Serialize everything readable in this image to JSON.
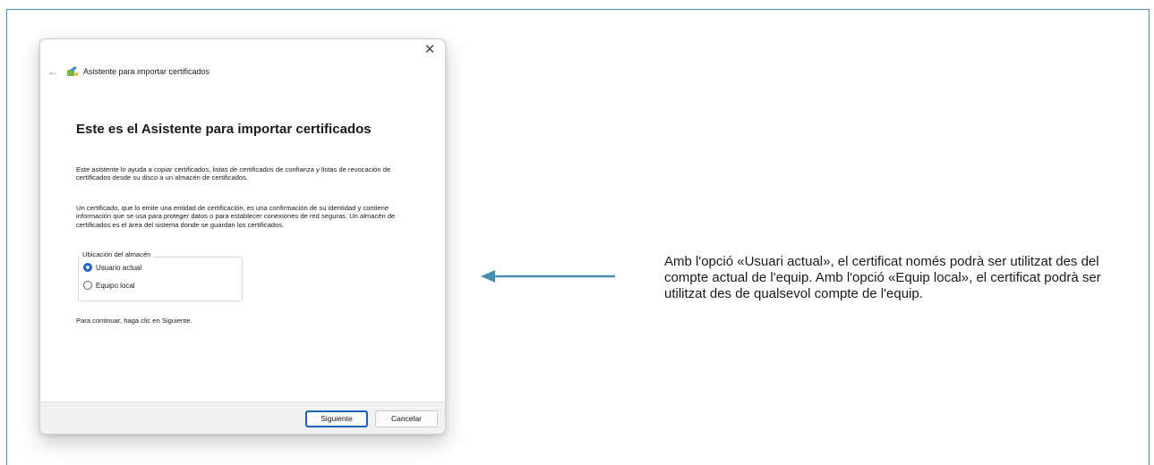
{
  "wizard": {
    "title": "Asistente para importar certificados",
    "heading": "Este es el Asistente para importar certificados",
    "paragraph1": "Este asistente lo ayuda a copiar certificados, listas de certificados de confianza y listas de revocación de certificados desde su disco a un almacén de certificados.",
    "paragraph2": "Un certificado, que lo emite una entidad de certificación, es una confirmación de su identidad y contiene información que se usa para proteger datos o para establecer conexiones de red seguras. Un almacén de certificados es el área del sistema donde se guardan los certificados.",
    "store_group_label": "Ubicación del almacén",
    "options": [
      {
        "label": "Usuario actual",
        "selected": true
      },
      {
        "label": "Equipo local",
        "selected": false
      }
    ],
    "continue_text": "Para continuar, haga clic en Siguiente.",
    "next_label": "Siguiente",
    "cancel_label": "Cancelar",
    "close_glyph": "✕",
    "back_glyph": "←"
  },
  "annotation": {
    "text": "Amb l'opció «Usuari actual», el certificat només podrà ser utilitzat des del compte actual de l'equip. Amb l'opció «Equip local», el certificat podrà ser utilitzat des de qualsevol compte de l'equip."
  },
  "colors": {
    "accent": "#1c5fbd",
    "arrow": "#4a8fb1",
    "frame_border": "#4a90b8"
  },
  "icons": [
    "close-icon",
    "back-arrow-icon",
    "certificate-wizard-icon",
    "annotation-arrow-icon"
  ]
}
